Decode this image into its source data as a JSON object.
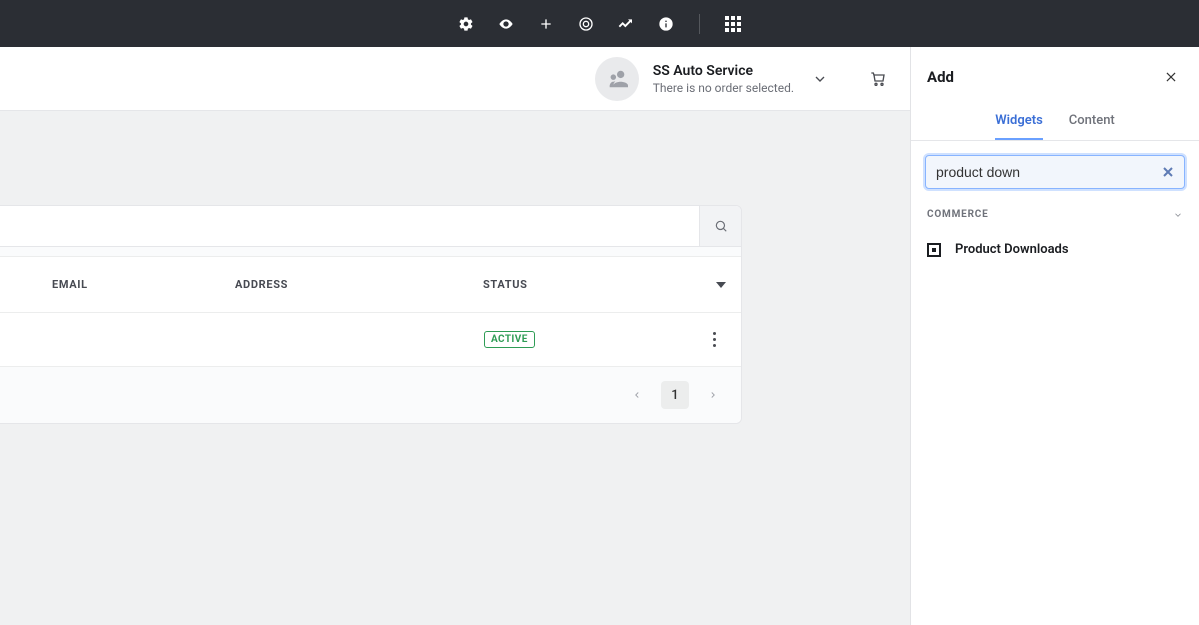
{
  "header": {
    "account_name": "SS Auto Service",
    "account_sub": "There is no order selected."
  },
  "table": {
    "columns": {
      "email": "EMAIL",
      "address": "ADDRESS",
      "status": "STATUS"
    },
    "row": {
      "status_badge": "ACTIVE"
    },
    "pager": {
      "current": "1"
    }
  },
  "sidepanel": {
    "title": "Add",
    "tabs": {
      "widgets": "Widgets",
      "content": "Content"
    },
    "search_value": "product down",
    "section_label": "COMMERCE",
    "result_label": "Product Downloads"
  }
}
